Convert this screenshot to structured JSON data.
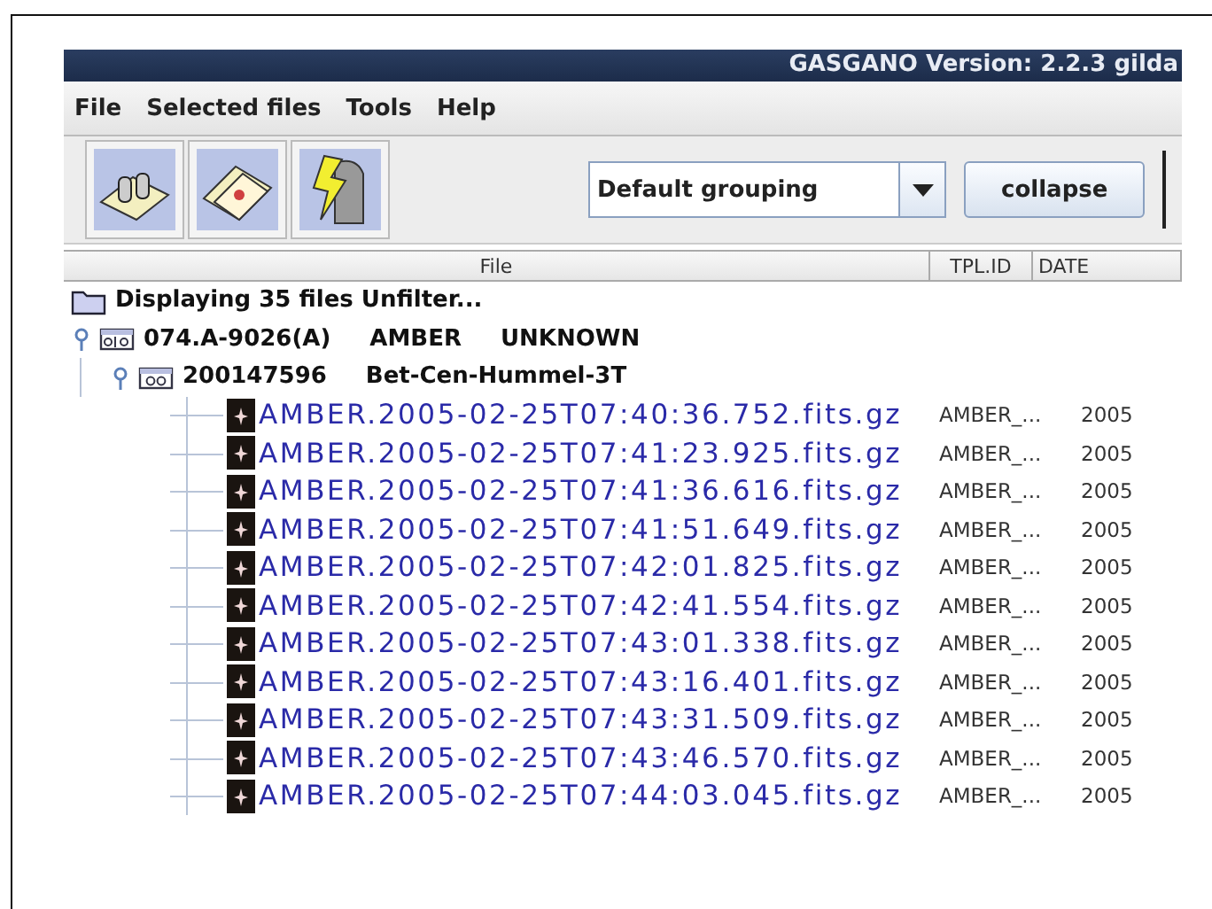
{
  "window": {
    "title": "GASGANO Version: 2.2.3  gilda"
  },
  "menu": [
    "File",
    "Selected files",
    "Tools",
    "Help"
  ],
  "grouping": {
    "value": "Default grouping"
  },
  "collapse_button": "collapse",
  "columns": [
    "File",
    "TPL.ID",
    "DATE"
  ],
  "summary": "Displaying 35 files Unfilter...",
  "programs": [
    {
      "label": "074.A-9026(A)",
      "instrument": "AMBER",
      "status": "UNKNOWN",
      "expanded": true,
      "blocks": [
        {
          "label": "200147596",
          "target": "Bet-Cen-Hummel-3T",
          "expanded": true,
          "files": [
            {
              "name": "AMBER.2005-02-25T07:40:36.752.fits.gz",
              "tpl_id": "AMBER_...",
              "date": "2005"
            },
            {
              "name": "AMBER.2005-02-25T07:41:23.925.fits.gz",
              "tpl_id": "AMBER_...",
              "date": "2005"
            },
            {
              "name": "AMBER.2005-02-25T07:41:36.616.fits.gz",
              "tpl_id": "AMBER_...",
              "date": "2005"
            },
            {
              "name": "AMBER.2005-02-25T07:41:51.649.fits.gz",
              "tpl_id": "AMBER_...",
              "date": "2005"
            },
            {
              "name": "AMBER.2005-02-25T07:42:01.825.fits.gz",
              "tpl_id": "AMBER_...",
              "date": "2005"
            },
            {
              "name": "AMBER.2005-02-25T07:42:41.554.fits.gz",
              "tpl_id": "AMBER_...",
              "date": "2005"
            },
            {
              "name": "AMBER.2005-02-25T07:43:01.338.fits.gz",
              "tpl_id": "AMBER_...",
              "date": "2005"
            },
            {
              "name": "AMBER.2005-02-25T07:43:16.401.fits.gz",
              "tpl_id": "AMBER_...",
              "date": "2005"
            },
            {
              "name": "AMBER.2005-02-25T07:43:31.509.fits.gz",
              "tpl_id": "AMBER_...",
              "date": "2005"
            },
            {
              "name": "AMBER.2005-02-25T07:43:46.570.fits.gz",
              "tpl_id": "AMBER_...",
              "date": "2005"
            },
            {
              "name": "AMBER.2005-02-25T07:44:03.045.fits.gz",
              "tpl_id": "AMBER_...",
              "date": "2005"
            }
          ]
        }
      ]
    }
  ]
}
